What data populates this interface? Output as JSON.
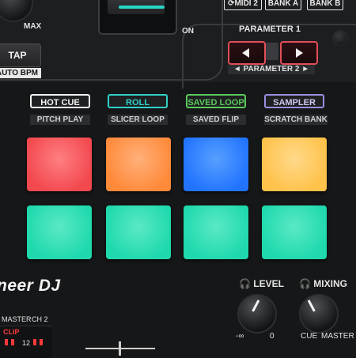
{
  "top": {
    "knob_label": "MAX",
    "midi_label": "MIDI 2",
    "bank_a": "BANK A",
    "bank_b": "BANK B",
    "on_label": "ON",
    "tap_label": "TAP",
    "auto_bpm_label": "AUTO BPM"
  },
  "parameter": {
    "title": "PARAMETER 1",
    "sub": "PARAMETER 2",
    "left_arrow": "◄",
    "right_arrow": "►"
  },
  "modes": [
    {
      "label": "HOT CUE",
      "sub": "PITCH PLAY",
      "color": "#f2f2f2"
    },
    {
      "label": "ROLL",
      "sub": "SLICER LOOP",
      "color": "#2fd2c8"
    },
    {
      "label": "SAVED LOOP",
      "sub": "SAVED FLIP",
      "color": "#58c95a"
    },
    {
      "label": "SAMPLER",
      "sub": "SCRATCH BANK",
      "color": "#9a8fe0"
    }
  ],
  "pads": [
    {
      "color": "#f2494f"
    },
    {
      "color": "#ff8a3a"
    },
    {
      "color": "#2274ff"
    },
    {
      "color": "#ffc24a"
    },
    {
      "color": "#1fd9ad"
    },
    {
      "color": "#1fd9ad"
    },
    {
      "color": "#1fd9ad"
    },
    {
      "color": "#1fd9ad"
    }
  ],
  "brand": "Pioneer DJ",
  "brand_visible": "neer DJ",
  "headphones": {
    "level_label": "LEVEL",
    "level_min": "-∞",
    "level_max": "0",
    "mixing_label": "MIXING",
    "mixing_left": "CUE",
    "mixing_right": "MASTER"
  },
  "meter": {
    "master_label": "MASTER",
    "ch2_label": "CH 2",
    "clip_label": "CLIP",
    "value_12": "12"
  },
  "icons": {
    "headphones": "headphones-icon",
    "midi": "midi-cycle-icon"
  }
}
